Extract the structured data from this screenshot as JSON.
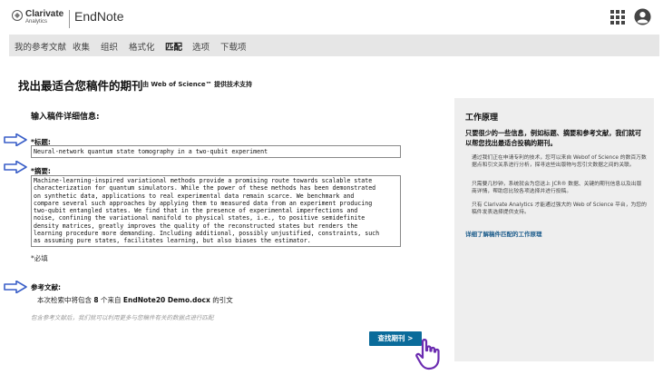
{
  "header": {
    "brand_name": "Clarivate",
    "brand_sub": "Analytics",
    "product": "EndNote",
    "icons": [
      "clarivate-logo-icon",
      "apps-grid-icon",
      "user-account-icon"
    ]
  },
  "nav": {
    "items": [
      {
        "label": "我的参考文献",
        "active": false
      },
      {
        "label": "收集",
        "active": false
      },
      {
        "label": "组织",
        "active": false
      },
      {
        "label": "格式化",
        "active": false
      },
      {
        "label": "匹配",
        "active": true
      },
      {
        "label": "选项",
        "active": false
      },
      {
        "label": "下载项",
        "active": false
      }
    ]
  },
  "page": {
    "title": "找出最适合您稿件的期刊",
    "powered_by": "由 Web of Science™ 提供技术支持"
  },
  "form": {
    "section_title": "输入稿件详细信息:",
    "title_label": "*标题:",
    "title_value": "Neural-network quantum state tomography in a two-qubit experiment",
    "abstract_label": "*摘要:",
    "abstract_value": "Machine-learning-inspired variational methods provide a promising route towards scalable state\ncharacterization for quantum simulators. While the power of these methods has been demonstrated\non synthetic data, applications to real experimental data remain scarce. We benchmark and\ncompare several such approaches by applying them to measured data from an experiment producing\ntwo-qubit entangled states. We find that in the presence of experimental imperfections and\nnoise, confining the variational manifold to physical states, i.e., to positive semidefinite\ndensity matrices, greatly improves the quality of the reconstructed states but renders the\nlearning procedure more demanding. Including additional, possibly unjustified, constraints, such\nas assuming pure states, facilitates learning, but also biases the estimator.",
    "required_note": "*必填",
    "references_label": "参考文献:",
    "references_prefix": "本次检索中将包含",
    "references_count": "8",
    "references_middle": "个来自",
    "references_file": "EndNote20 Demo.docx",
    "references_suffix": "的引文",
    "hint": "包含参考文献后，我们就可以利用更多与您稿件有关的数据点进行匹配",
    "submit_label": "查找期刊 >"
  },
  "side": {
    "title": "工作原理",
    "lead": "只要很少的一些信息，例如标题、摘要和参考文献，我们就可以帮您找出最适合投稿的期刊。",
    "p1": "通过我们正在申请专利的技术，您可以来自 Webof of Science 的数百万数据点和引文关系进行分析，探寻这些出版物与您引文数据之间的关联。",
    "p2": "只需要几秒钟，系统就会为您送上 JCR® 数据、关键的期刊信息以及出版商详情，帮助您比较各项选择并进行投稿。",
    "p3": "只有 Clarivate Analytics 才能通过强大的 Web of Science 平台，为您的稿件发表选择提供支持。",
    "link": "详细了解稿件匹配的工作原理"
  },
  "colors": {
    "accent": "#0a6b9a",
    "arrow": "#3a5fc8",
    "cursor": "#6b2bb0",
    "nav_bg": "#e6e6e6",
    "side_bg": "#eeeeee"
  }
}
